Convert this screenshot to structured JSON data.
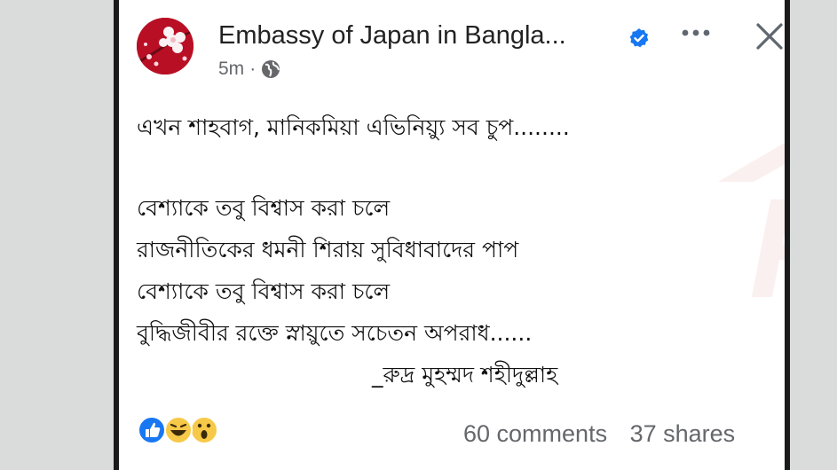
{
  "post": {
    "page_name": "Embassy of Japan in Bangla...",
    "timestamp": "5m",
    "separator": "·",
    "lines": [
      "এখন শাহবাগ, মানিকমিয়া এভিনিয়্যু সব চুপ........",
      "বেশ্যাকে তবু বিশ্বাস করা চলে",
      "রাজনীতিকের ধমনী শিরায় সুবিধাবাদের পাপ",
      "বেশ্যাকে তবু বিশ্বাস করা চলে",
      "বুদ্ধিজীবীর রক্তে স্নায়ুতে সচেতন অপরাধ......",
      "_রুদ্র মুহম্মদ শহীদুল্লাহ"
    ],
    "comments": "60 comments",
    "shares": "37 shares",
    "watermark_letter": "R"
  },
  "icons": {
    "verified": "verified-badge-icon",
    "more": "more-options-icon",
    "close": "close-icon",
    "audience": "globe-icon",
    "reactions": [
      "like-reaction-icon",
      "haha-reaction-icon",
      "wow-reaction-icon"
    ]
  },
  "colors": {
    "brand_blue": "#1877f2",
    "avatar_red": "#b80f24",
    "meta_gray": "#65676b",
    "reaction_yellow": "#f7c948"
  }
}
